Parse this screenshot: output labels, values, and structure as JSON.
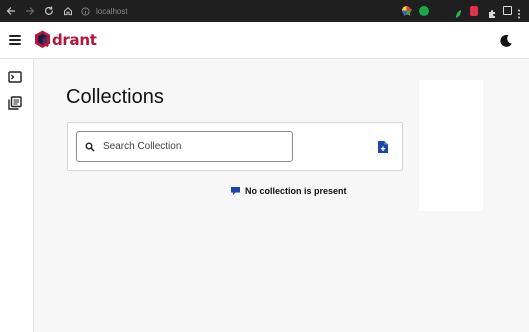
{
  "browser": {
    "url": "localhost"
  },
  "header": {
    "logo_text": "drant",
    "brand_color": "#b3163a"
  },
  "main": {
    "title": "Collections",
    "search": {
      "placeholder": "Search Collection",
      "value": ""
    },
    "empty_message": "No collection is present"
  },
  "icons": {
    "back": "arrow-left-icon",
    "forward": "arrow-right-icon",
    "reload": "reload-icon",
    "home": "home-icon",
    "menu": "hamburger-icon",
    "theme": "moon-icon",
    "console": "terminal-icon",
    "collections": "library-icon",
    "add_collection": "file-plus-icon",
    "empty": "chat-bubble-icon"
  },
  "colors": {
    "accent": "#1a47a8",
    "chrome": "#1f1f1f"
  }
}
